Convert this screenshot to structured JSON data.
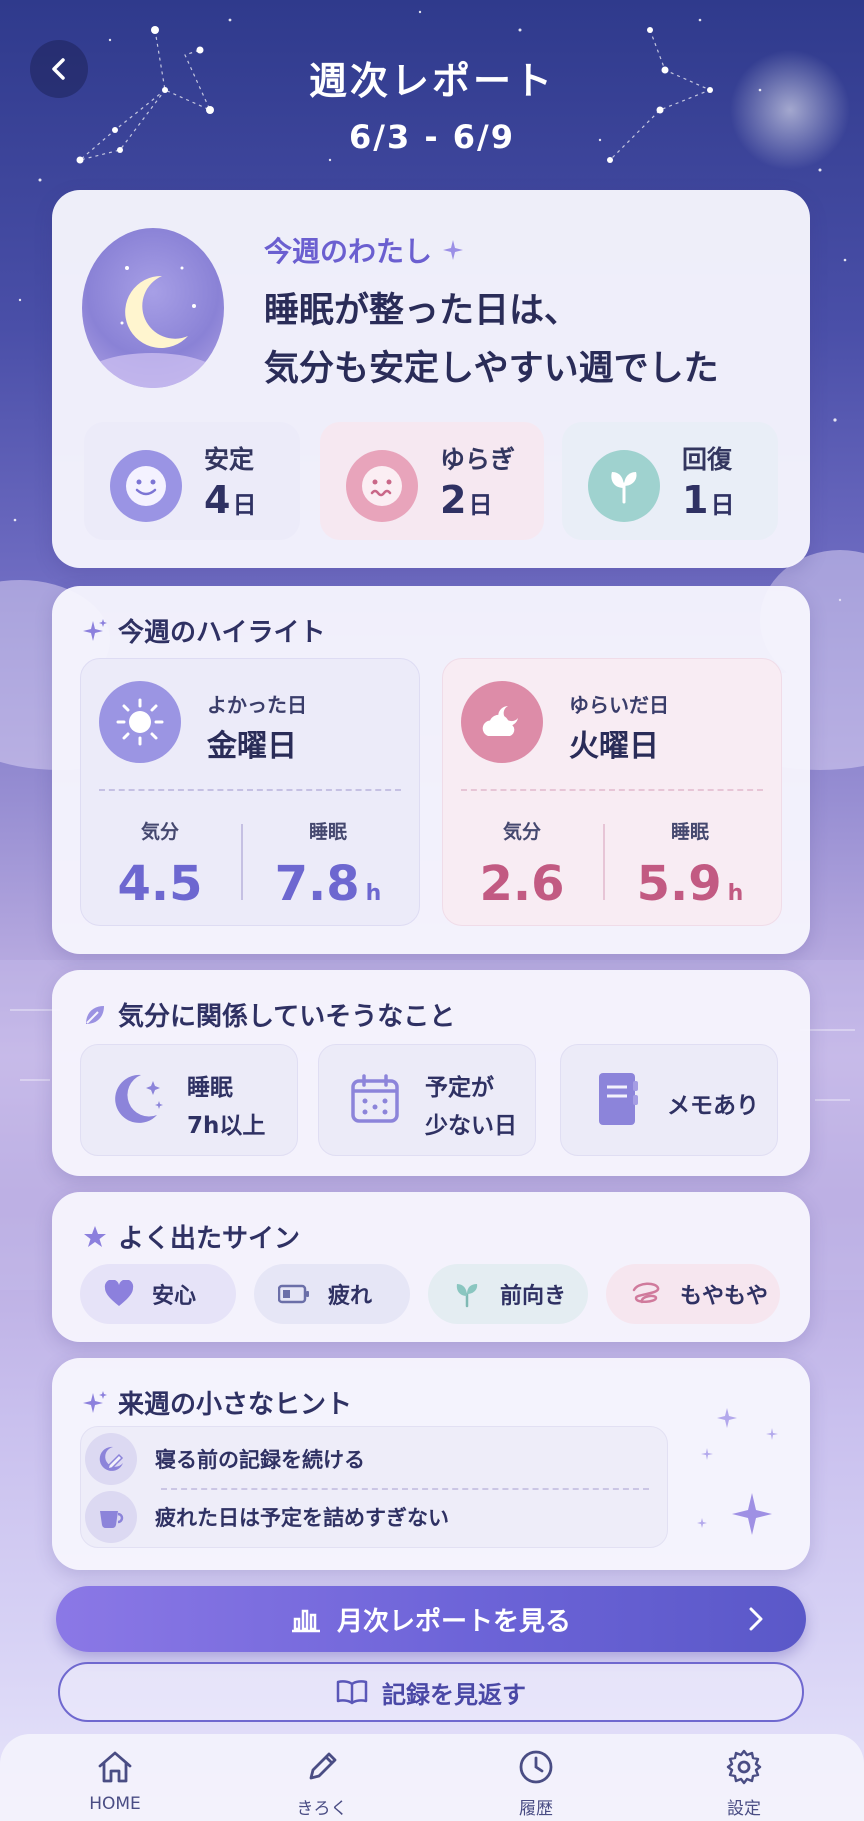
{
  "header": {
    "title": "週次レポート",
    "date_range": "6/3 - 6/9"
  },
  "summary": {
    "label": "今週のわたし",
    "message_line1": "睡眠が整った日は、",
    "message_line2": "気分も安定しやすい週でした",
    "stats": [
      {
        "label": "安定",
        "value": "4",
        "unit": "日",
        "color": "#8f8ae0"
      },
      {
        "label": "ゆらぎ",
        "value": "2",
        "unit": "日",
        "color": "#e597b0"
      },
      {
        "label": "回復",
        "value": "1",
        "unit": "日",
        "color": "#8dc9c8"
      }
    ]
  },
  "highlights": {
    "title": "今週のハイライト",
    "good": {
      "sub": "よかった日",
      "day": "金曜日",
      "mood_label": "気分",
      "mood": "4.5",
      "sleep_label": "睡眠",
      "sleep": "7.8",
      "sleep_unit": "h"
    },
    "bad": {
      "sub": "ゆらいだ日",
      "day": "火曜日",
      "mood_label": "気分",
      "mood": "2.6",
      "sleep_label": "睡眠",
      "sleep": "5.9",
      "sleep_unit": "h"
    }
  },
  "factors": {
    "title": "気分に関係していそうなこと",
    "items": [
      {
        "line1": "睡眠",
        "line2": "7h以上",
        "icon": "moon-stars-icon"
      },
      {
        "line1": "予定が",
        "line2": "少ない日",
        "icon": "calendar-icon"
      },
      {
        "line1": "メモあり",
        "line2": "",
        "icon": "notebook-icon"
      }
    ]
  },
  "signs": {
    "title": "よく出たサイン",
    "items": [
      {
        "label": "安心",
        "icon": "heart-icon"
      },
      {
        "label": "疲れ",
        "icon": "battery-low-icon"
      },
      {
        "label": "前向き",
        "icon": "sprout-icon"
      },
      {
        "label": "もやもや",
        "icon": "scribble-icon"
      }
    ]
  },
  "hints": {
    "title": "来週の小さなヒント",
    "items": [
      {
        "text": "寝る前の記録を続ける",
        "icon": "moon-pen-icon"
      },
      {
        "text": "疲れた日は予定を詰めすぎない",
        "icon": "teacup-icon"
      }
    ]
  },
  "actions": {
    "monthly": "月次レポートを見る",
    "review": "記録を見返す"
  },
  "tabs": [
    {
      "label": "HOME",
      "icon": "home-icon"
    },
    {
      "label": "きろく",
      "icon": "pencil-icon"
    },
    {
      "label": "履歴",
      "icon": "clock-icon"
    },
    {
      "label": "設定",
      "icon": "gear-icon"
    }
  ]
}
